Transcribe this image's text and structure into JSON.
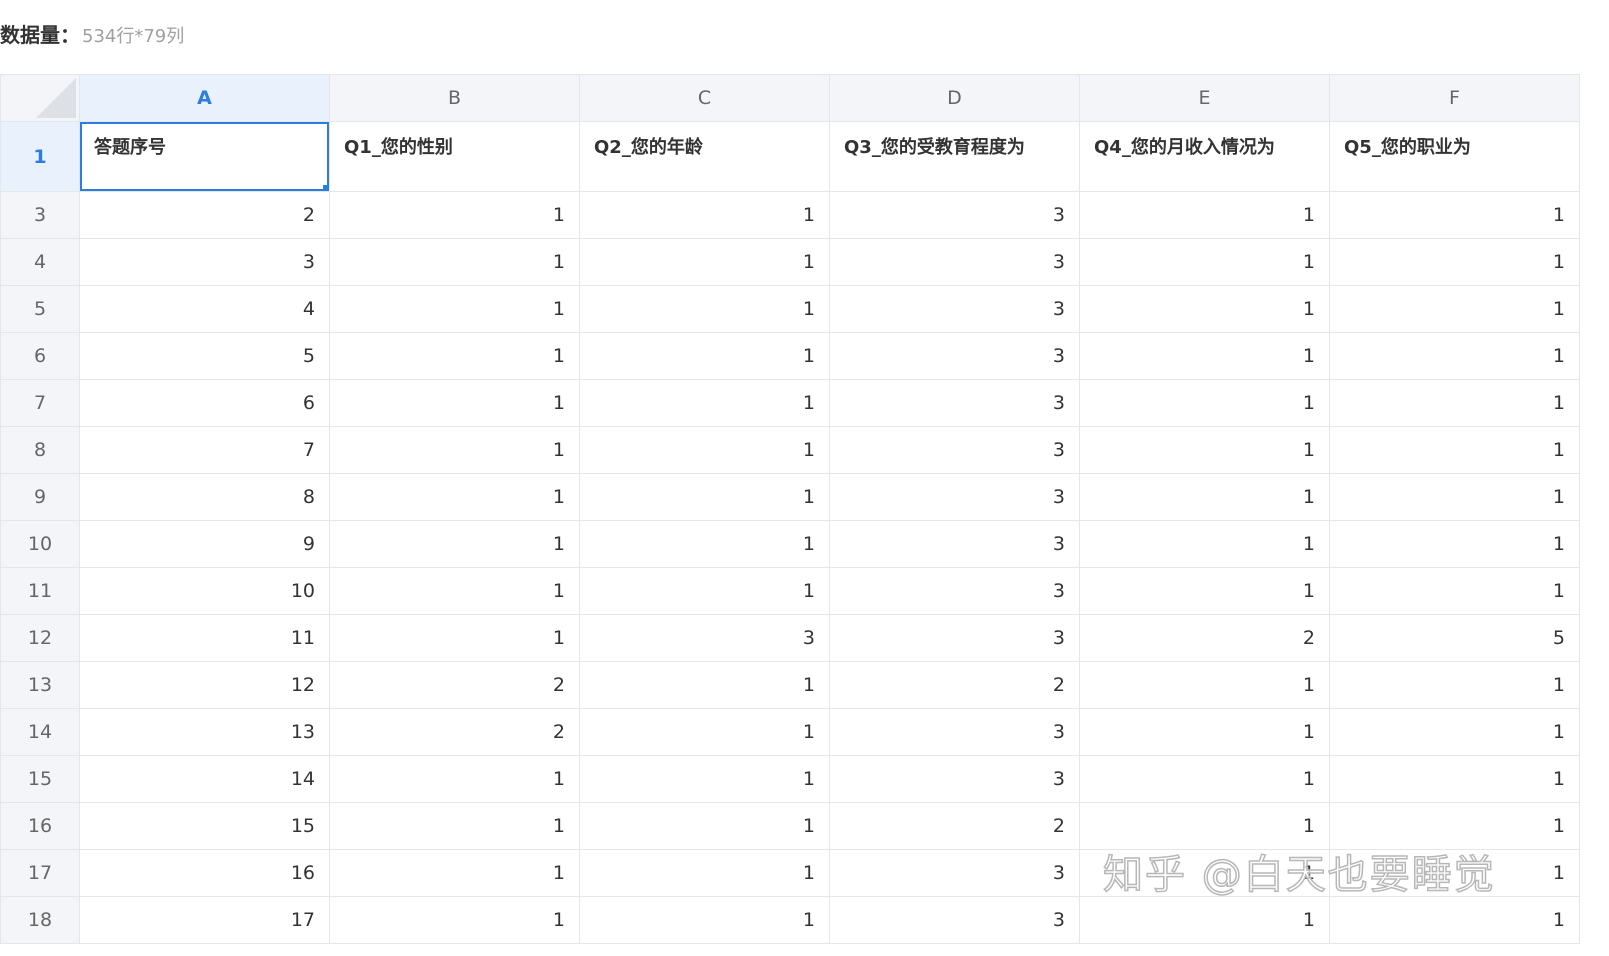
{
  "summary": {
    "label": "数据量：",
    "value": "534行*79列"
  },
  "columns": [
    "A",
    "B",
    "C",
    "D",
    "E",
    "F"
  ],
  "active_column": "A",
  "header_row": {
    "row_number": "1",
    "cells": [
      "答题序号",
      "Q1_您的性别",
      "Q2_您的年龄",
      "Q3_您的受教育程度为",
      "Q4_您的月收入情况为",
      "Q5_您的职业为"
    ]
  },
  "rows": [
    {
      "row_number": "3",
      "cells": [
        "2",
        "1",
        "1",
        "3",
        "1",
        "1"
      ]
    },
    {
      "row_number": "4",
      "cells": [
        "3",
        "1",
        "1",
        "3",
        "1",
        "1"
      ]
    },
    {
      "row_number": "5",
      "cells": [
        "4",
        "1",
        "1",
        "3",
        "1",
        "1"
      ]
    },
    {
      "row_number": "6",
      "cells": [
        "5",
        "1",
        "1",
        "3",
        "1",
        "1"
      ]
    },
    {
      "row_number": "7",
      "cells": [
        "6",
        "1",
        "1",
        "3",
        "1",
        "1"
      ]
    },
    {
      "row_number": "8",
      "cells": [
        "7",
        "1",
        "1",
        "3",
        "1",
        "1"
      ]
    },
    {
      "row_number": "9",
      "cells": [
        "8",
        "1",
        "1",
        "3",
        "1",
        "1"
      ]
    },
    {
      "row_number": "10",
      "cells": [
        "9",
        "1",
        "1",
        "3",
        "1",
        "1"
      ]
    },
    {
      "row_number": "11",
      "cells": [
        "10",
        "1",
        "1",
        "3",
        "1",
        "1"
      ]
    },
    {
      "row_number": "12",
      "cells": [
        "11",
        "1",
        "3",
        "3",
        "2",
        "5"
      ]
    },
    {
      "row_number": "13",
      "cells": [
        "12",
        "2",
        "1",
        "2",
        "1",
        "1"
      ]
    },
    {
      "row_number": "14",
      "cells": [
        "13",
        "2",
        "1",
        "3",
        "1",
        "1"
      ]
    },
    {
      "row_number": "15",
      "cells": [
        "14",
        "1",
        "1",
        "3",
        "1",
        "1"
      ]
    },
    {
      "row_number": "16",
      "cells": [
        "15",
        "1",
        "1",
        "2",
        "1",
        "1"
      ]
    },
    {
      "row_number": "17",
      "cells": [
        "16",
        "1",
        "1",
        "3",
        "1",
        "1"
      ]
    },
    {
      "row_number": "18",
      "cells": [
        "17",
        "1",
        "1",
        "3",
        "1",
        "1"
      ]
    }
  ],
  "watermark": "知乎 @白天也要睡觉",
  "colors": {
    "accent": "#2b7de0",
    "header_bg": "#f3f5f8",
    "active_header_bg": "#e8f1fc",
    "grid_line": "#e3e6ea"
  }
}
